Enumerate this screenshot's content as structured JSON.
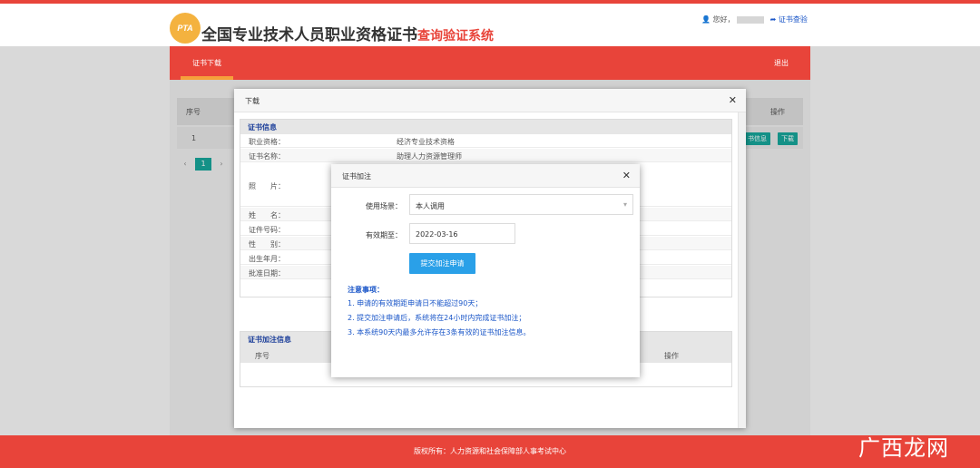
{
  "header": {
    "logo_text": "PTA",
    "title_main": "全国专业技术人员职业资格证书",
    "title_sub": "查询验证系统",
    "greeting": "您好，",
    "verify_link": "证书查验"
  },
  "nav": {
    "tab_download": "证书下载",
    "logout": "退出"
  },
  "bg_table": {
    "col_index": "序号",
    "col_action": "操作",
    "row_index": "1",
    "btn_info": "书信息",
    "btn_download": "下载",
    "page_current": "1"
  },
  "dialog": {
    "title": "下载",
    "section_cert": "证书信息",
    "rows": [
      {
        "label": "职业资格：",
        "value": "经济专业技术资格"
      },
      {
        "label": "证书名称：",
        "value": "助理人力资源管理师"
      },
      {
        "label": "照　　片："
      },
      {
        "label": "姓　　名："
      },
      {
        "label": "证件号码："
      },
      {
        "label": "性　　别："
      },
      {
        "label": "出生年月："
      },
      {
        "label": "批准日期："
      }
    ],
    "section_note": "证书加注信息",
    "note_col_index": "序号",
    "note_col_action": "操作"
  },
  "modal": {
    "title": "证书加注",
    "scene_label": "使用场景：",
    "scene_value": "本人调用",
    "expiry_label": "有效期至：",
    "expiry_value": "2022-03-16",
    "submit": "提交加注申请",
    "notes_title": "注意事项：",
    "notes": [
      "1. 申请的有效期距申请日不能超过90天；",
      "2. 提交加注申请后，系统将在24小时内完成证书加注；",
      "3. 本系统90天内最多允许存在3条有效的证书加注信息。"
    ]
  },
  "footer": {
    "copyright": "版权所有：人力资源和社会保障部人事考试中心"
  },
  "watermark": "广西龙网"
}
